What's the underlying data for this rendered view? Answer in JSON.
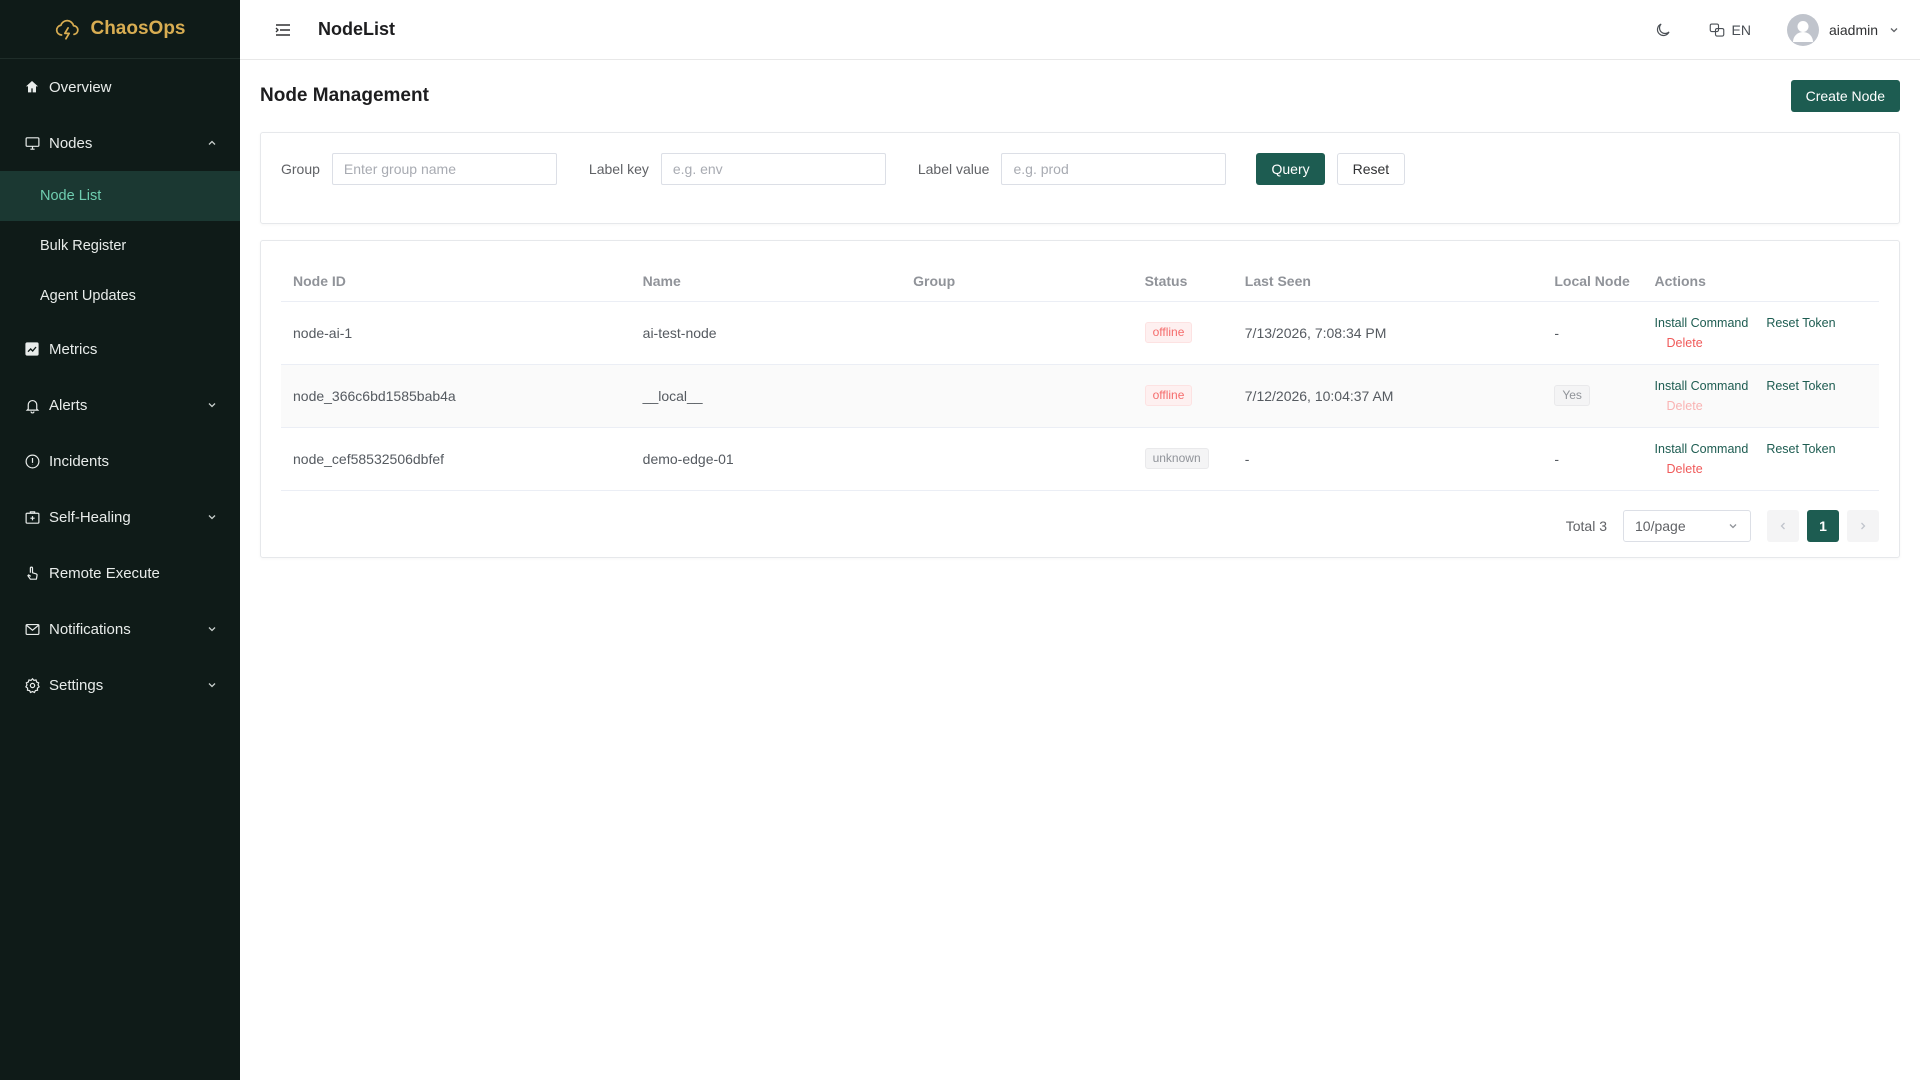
{
  "brand": {
    "name": "ChaosOps"
  },
  "colors": {
    "sidebar_bg": "#0f1b18",
    "brand": "#d8ad52",
    "primary": "#1d5c51",
    "danger": "#f05a5a",
    "active_sub_bg": "#1b3832",
    "active_sub_text": "#6fcdb0"
  },
  "sidebar": {
    "items": [
      {
        "label": "Overview",
        "icon": "home-icon"
      },
      {
        "label": "Nodes",
        "icon": "monitor-icon",
        "expanded": true,
        "children": [
          {
            "label": "Node List",
            "active": true
          },
          {
            "label": "Bulk Register"
          },
          {
            "label": "Agent Updates"
          }
        ]
      },
      {
        "label": "Metrics",
        "icon": "chart-icon"
      },
      {
        "label": "Alerts",
        "icon": "bell-icon",
        "expandable": true
      },
      {
        "label": "Incidents",
        "icon": "info-icon"
      },
      {
        "label": "Self-Healing",
        "icon": "first-aid-icon",
        "expandable": true
      },
      {
        "label": "Remote Execute",
        "icon": "pointer-icon"
      },
      {
        "label": "Notifications",
        "icon": "mail-icon",
        "expandable": true
      },
      {
        "label": "Settings",
        "icon": "gear-icon",
        "expandable": true
      }
    ]
  },
  "header": {
    "title": "NodeList",
    "language": "EN",
    "username": "aiadmin"
  },
  "page": {
    "title": "Node Management",
    "create_label": "Create Node"
  },
  "filters": {
    "group": {
      "label": "Group",
      "placeholder": "Enter group name",
      "value": ""
    },
    "label_key": {
      "label": "Label key",
      "placeholder": "e.g. env",
      "value": ""
    },
    "label_value": {
      "label": "Label value",
      "placeholder": "e.g. prod",
      "value": ""
    },
    "query_label": "Query",
    "reset_label": "Reset"
  },
  "table": {
    "columns": [
      "Node ID",
      "Name",
      "Group",
      "Status",
      "Last Seen",
      "Local Node",
      "Actions"
    ],
    "rows": [
      {
        "id": "node-ai-1",
        "name": "ai-test-node",
        "group": "",
        "status": "offline",
        "last_seen": "7/13/2026, 7:08:34 PM",
        "local": "-",
        "local_tag": false,
        "delete_disabled": false
      },
      {
        "id": "node_366c6bd1585bab4a",
        "name": "__local__",
        "group": "",
        "status": "offline",
        "last_seen": "7/12/2026, 10:04:37 AM",
        "local": "Yes",
        "local_tag": true,
        "delete_disabled": true
      },
      {
        "id": "node_cef58532506dbfef",
        "name": "demo-edge-01",
        "group": "",
        "status": "unknown",
        "last_seen": "-",
        "local": "-",
        "local_tag": false,
        "delete_disabled": false
      }
    ],
    "actions": {
      "install": "Install Command",
      "reset": "Reset Token",
      "delete": "Delete"
    }
  },
  "pagination": {
    "total_text": "Total 3",
    "page_size": "10/page",
    "current_page": "1"
  }
}
